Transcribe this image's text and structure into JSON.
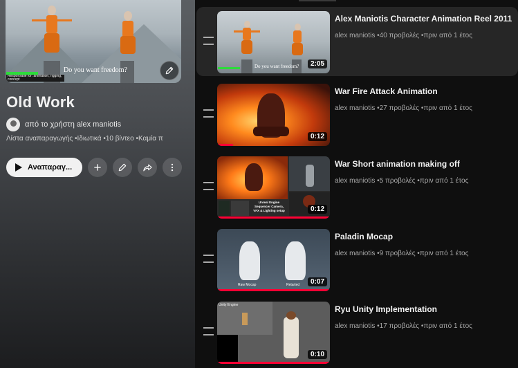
{
  "playlist": {
    "cover_caption": "Do you want freedom?",
    "cover_label": "Responsible for: animation, rigging, concept",
    "title": "Old Work",
    "author": "από το χρήστη alex maniotis",
    "meta": [
      "Λίστα αναπαραγωγής",
      "Ιδιωτικά",
      "10 βίντεο",
      "Καμία π"
    ],
    "play_label": "Αναπαραγ...",
    "icons": {
      "edit": "pencil-icon",
      "add": "plus-icon",
      "share": "share-icon",
      "more": "more-vert-icon",
      "play": "play-icon",
      "drag": "drag-handle-icon"
    }
  },
  "videos": [
    {
      "title": "Alex Maniotis Character Animation Reel 2011",
      "channel": "alex maniotis",
      "views": "40 προβολές",
      "age": "πριν από 1 έτος",
      "duration": "2:05",
      "thumb_caption": "Do you want freedom?",
      "watched": 0
    },
    {
      "title": "War Fire Attack Animation",
      "channel": "alex maniotis",
      "views": "27 προβολές",
      "age": "πριν από 1 έτος",
      "duration": "0:12",
      "watched": 0.14
    },
    {
      "title": "War Short animation making off",
      "channel": "alex maniotis",
      "views": "5 προβολές",
      "age": "πριν από 1 έτος",
      "duration": "0:12",
      "thumb_caption": "Unreal Engine Sequencer Camera, VFX & Lighting setup",
      "watched": 1
    },
    {
      "title": "Paladin Mocap",
      "channel": "alex maniotis",
      "views": "9 προβολές",
      "age": "πριν από 1 έτος",
      "duration": "0:07",
      "thumb_caption_left": "Raw Mocap",
      "thumb_caption_right": "Retarted",
      "watched": 1
    },
    {
      "title": "Ryu Unity Implementation",
      "channel": "alex maniotis",
      "views": "17 προβολές",
      "age": "πριν από 1 έτος",
      "duration": "0:10",
      "thumb_caption": "Unity Engine",
      "watched": 1
    }
  ],
  "colors": {
    "background": "#0f0f0f",
    "selected_row": "#262626",
    "progress": "#ff0033",
    "text_primary": "#f1f1f1",
    "text_secondary": "#aaaaaa"
  }
}
